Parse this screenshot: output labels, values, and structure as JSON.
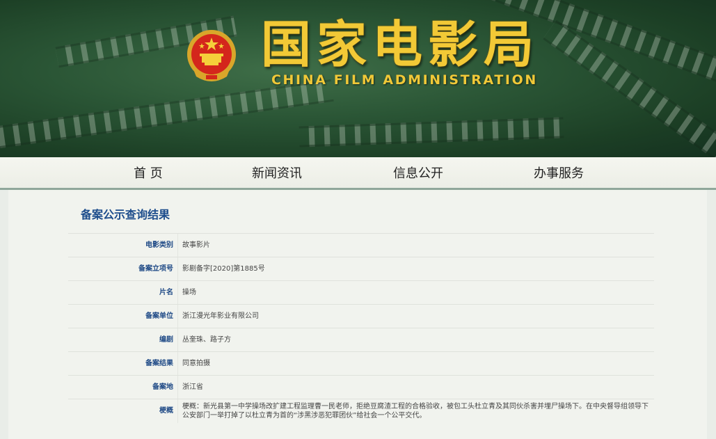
{
  "header": {
    "title_cn": "国家电影局",
    "title_en": "CHINA FILM ADMINISTRATION",
    "emblem_icon": "national-emblem-icon"
  },
  "nav": {
    "items": [
      {
        "label": "首 页"
      },
      {
        "label": "新闻资讯"
      },
      {
        "label": "信息公开"
      },
      {
        "label": "办事服务"
      }
    ]
  },
  "main": {
    "section_title": "备案公示查询结果",
    "rows": [
      {
        "label": "电影类别",
        "value": "故事影片"
      },
      {
        "label": "备案立项号",
        "value": "影剧备字[2020]第1885号"
      },
      {
        "label": "片名",
        "value": "操场"
      },
      {
        "label": "备案单位",
        "value": "浙江漫光年影业有限公司"
      },
      {
        "label": "编剧",
        "value": "丛奎珠、路子方"
      },
      {
        "label": "备案结果",
        "value": "同意拍摄"
      },
      {
        "label": "备案地",
        "value": "浙江省"
      },
      {
        "label": "梗概",
        "value": "梗概：新光县第一中学操场改扩建工程监理曹一民老师，拒绝豆腐渣工程的合格验收，被包工头杜立青及其同伙杀害并埋尸操场下。在中央督导组领导下公安部门一举打掉了以杜立青为首的“涉黑涉恶犯罪团伙”给社会一个公平交代。"
      }
    ]
  },
  "colors": {
    "header_green": "#2a5535",
    "title_gold": "#f2c936",
    "label_blue": "#1f4a86",
    "section_title_blue": "#1d4d8c"
  }
}
